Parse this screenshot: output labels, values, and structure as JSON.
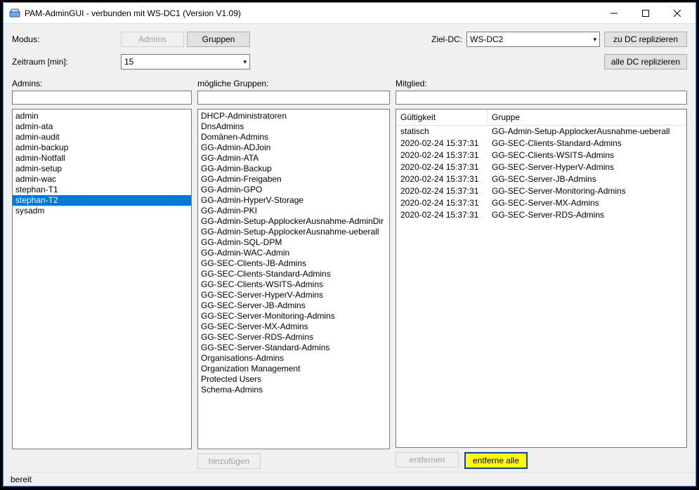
{
  "window": {
    "title": "PAM-AdminGUI - verbunden mit WS-DC1 (Version V1.09)"
  },
  "labels": {
    "modus": "Modus:",
    "zeitraum": "Zeitraum [min]:",
    "ziel_dc": "Ziel-DC:",
    "admins": "Admins:",
    "gruppen_moeglich": "mögliche Gruppen:",
    "mitglied": "Mitglied:"
  },
  "buttons": {
    "admins": "Admins",
    "gruppen": "Gruppen",
    "zu_dc": "zu DC replizieren",
    "alle_dc": "alle DC replizieren",
    "hinzufuegen": "hinzufügen",
    "entfernen": "entfernen",
    "entferne_alle": "entferne alle"
  },
  "combos": {
    "zeitraum_value": "15",
    "ziel_dc_value": "WS-DC2"
  },
  "filters": {
    "admins": "",
    "groups": "",
    "member": ""
  },
  "admins_list": [
    "admin",
    "admin-ata",
    "admin-audit",
    "admin-backup",
    "admin-Notfall",
    "admin-setup",
    "admin-wac",
    "stephan-T1",
    "stephan-T2",
    "sysadm"
  ],
  "admins_selected_index": 8,
  "groups_list": [
    "DHCP-Administratoren",
    "DnsAdmins",
    "Domänen-Admins",
    "GG-Admin-ADJoin",
    "GG-Admin-ATA",
    "GG-Admin-Backup",
    "GG-Admin-Freigaben",
    "GG-Admin-GPO",
    "GG-Admin-HyperV-Storage",
    "GG-Admin-PKI",
    "GG-Admin-Setup-ApplockerAusnahme-AdminDir",
    "GG-Admin-Setup-ApplockerAusnahme-ueberall",
    "GG-Admin-SQL-DPM",
    "GG-Admin-WAC-Admin",
    "GG-SEC-Clients-JB-Admins",
    "GG-SEC-Clients-Standard-Admins",
    "GG-SEC-Clients-WSITS-Admins",
    "GG-SEC-Server-HyperV-Admins",
    "GG-SEC-Server-JB-Admins",
    "GG-SEC-Server-Monitoring-Admins",
    "GG-SEC-Server-MX-Admins",
    "GG-SEC-Server-RDS-Admins",
    "GG-SEC-Server-Standard-Admins",
    "Organisations-Admins",
    "Organization Management",
    "Protected Users",
    "Schema-Admins"
  ],
  "member_grid": {
    "col_gueltigkeit": "Gültigkeit",
    "col_gruppe": "Gruppe",
    "rows": [
      {
        "g": "statisch",
        "grp": "GG-Admin-Setup-ApplockerAusnahme-ueberall"
      },
      {
        "g": "2020-02-24 15:37:31",
        "grp": "GG-SEC-Clients-Standard-Admins"
      },
      {
        "g": "2020-02-24 15:37:31",
        "grp": "GG-SEC-Clients-WSITS-Admins"
      },
      {
        "g": "2020-02-24 15:37:31",
        "grp": "GG-SEC-Server-HyperV-Admins"
      },
      {
        "g": "2020-02-24 15:37:31",
        "grp": "GG-SEC-Server-JB-Admins"
      },
      {
        "g": "2020-02-24 15:37:31",
        "grp": "GG-SEC-Server-Monitoring-Admins"
      },
      {
        "g": "2020-02-24 15:37:31",
        "grp": "GG-SEC-Server-MX-Admins"
      },
      {
        "g": "2020-02-24 15:37:31",
        "grp": "GG-SEC-Server-RDS-Admins"
      }
    ]
  },
  "status": "bereit"
}
